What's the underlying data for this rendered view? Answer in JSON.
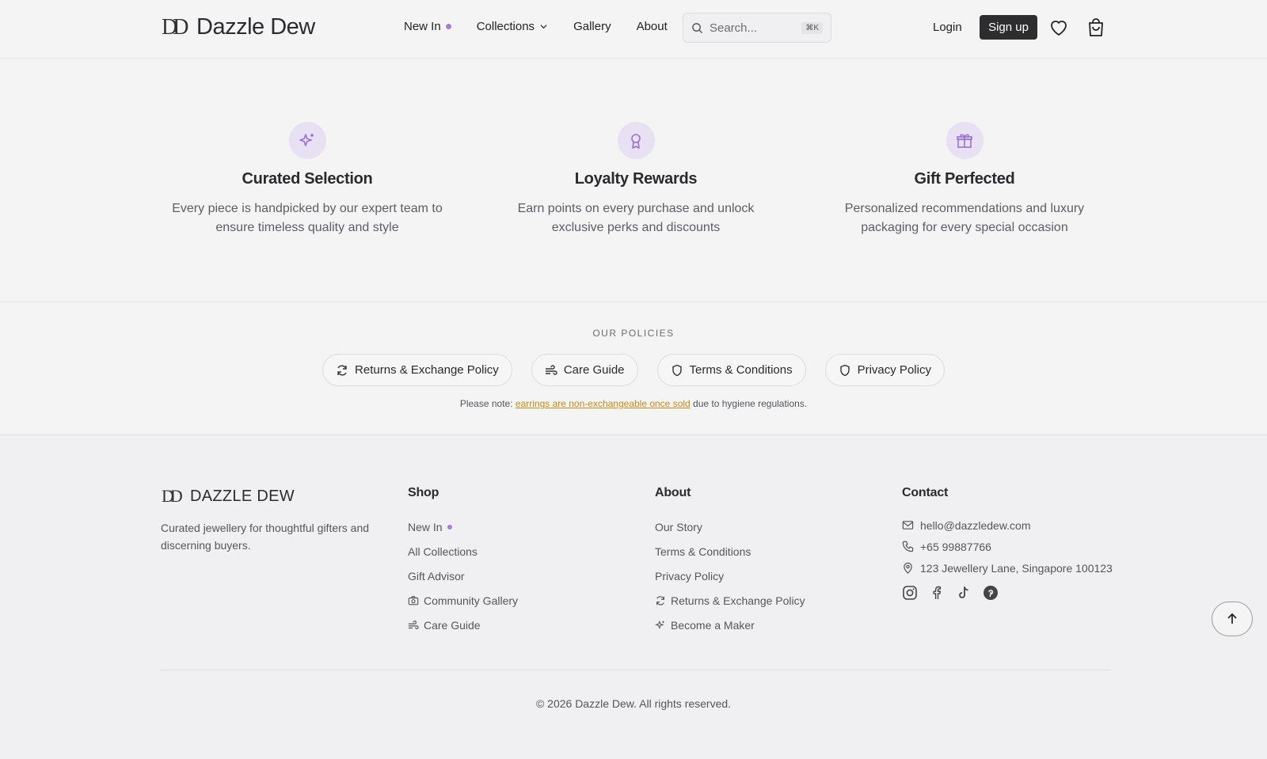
{
  "brand": {
    "name": "Dazzle Dew",
    "footer_name": "DAZZLE DEW",
    "mark": "DD"
  },
  "nav": {
    "new_in": "New In",
    "collections": "Collections",
    "gallery": "Gallery",
    "about": "About"
  },
  "search": {
    "placeholder": "Search...",
    "shortcut": "⌘K"
  },
  "auth": {
    "login": "Login",
    "signup": "Sign up"
  },
  "features": [
    {
      "icon": "sparkles-icon",
      "title": "Curated Selection",
      "line1": "Every piece is handpicked by our expert team to",
      "line2": "ensure timeless quality and style"
    },
    {
      "icon": "award-icon",
      "title": "Loyalty Rewards",
      "line1": "Earn points on every purchase and unlock",
      "line2": "exclusive perks and discounts"
    },
    {
      "icon": "gift-icon",
      "title": "Gift Perfected",
      "line1": "Personalized recommendations and luxury",
      "line2": "packaging for every special occasion"
    }
  ],
  "policies": {
    "title": "OUR POLICIES",
    "items": [
      "Returns & Exchange Policy",
      "Care Guide",
      "Terms & Conditions",
      "Privacy Policy"
    ],
    "note_prefix": "Please note: ",
    "note_highlight": "earrings are non-exchangeable once sold",
    "note_suffix": " due to hygiene regulations."
  },
  "footer": {
    "tagline": "Curated jewellery for thoughtful gifters and discerning buyers.",
    "shop": {
      "title": "Shop",
      "links": [
        "New In",
        "All Collections",
        "Gift Advisor",
        "Community Gallery",
        "Care Guide"
      ]
    },
    "about": {
      "title": "About",
      "links": [
        "Our Story",
        "Terms & Conditions",
        "Privacy Policy",
        "Returns & Exchange Policy",
        "Become a Maker"
      ]
    },
    "contact": {
      "title": "Contact",
      "email": "hello@dazzledew.com",
      "phone": "+65 99887766",
      "address": "123 Jewellery Lane, Singapore 100123"
    },
    "copyright": "© 2026 Dazzle Dew. All rights reserved."
  },
  "colors": {
    "accent": "#a67ed6",
    "highlight": "#c08a1a",
    "dark": "#2d2d30"
  }
}
